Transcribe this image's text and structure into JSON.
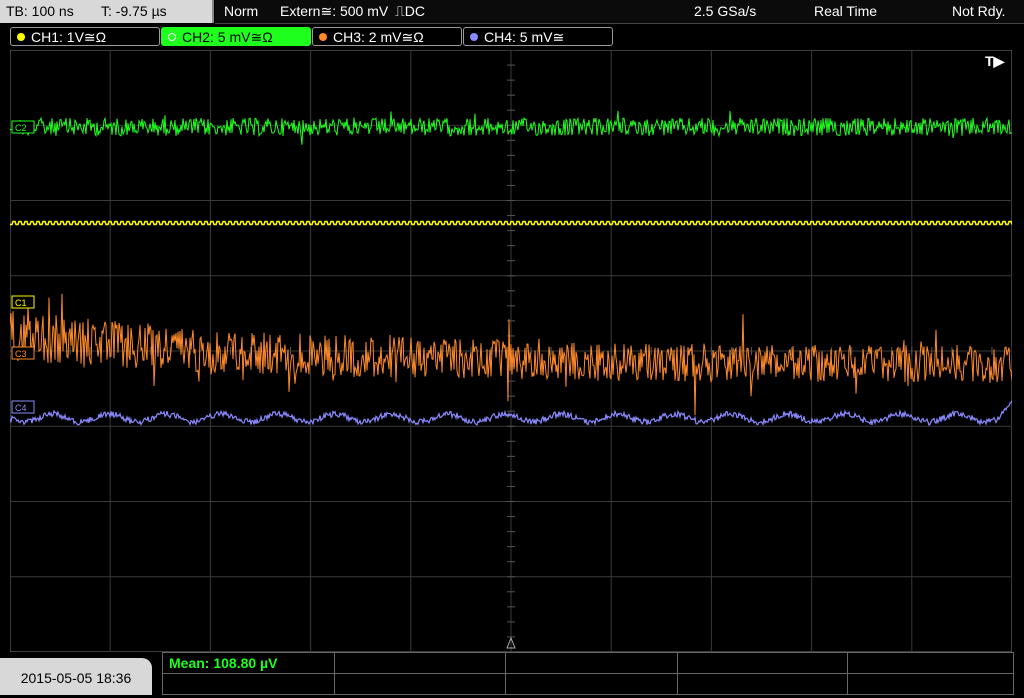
{
  "topbar": {
    "timebase": "TB: 100 ns",
    "trigger_time": "T: -9.75 µs",
    "mode": "Norm",
    "trigger_source": "Extern≅: 500 mV",
    "trigger_slope_coupling": "⎍DC",
    "sample_rate": "2.5 GSa/s",
    "acq_mode": "Real Time",
    "status": "Not Rdy."
  },
  "channels": [
    {
      "label": "CH1: 1V≅Ω",
      "color": "#ffff00",
      "active": false
    },
    {
      "label": "CH2: 5 mV≅Ω",
      "color": "#1eff1e",
      "active": true
    },
    {
      "label": "CH3: 2 mV≅Ω",
      "color": "#ff8a2a",
      "active": false
    },
    {
      "label": "CH4: 5 mV≅",
      "color": "#8a8aff",
      "active": false
    }
  ],
  "grid": {
    "marker_labels": {
      "c1": "C1",
      "c2": "C2",
      "c3": "C3",
      "c4": "C4",
      "trigger": "T▶"
    }
  },
  "traces": {
    "ch1_color": "#ffff00",
    "ch2_color": "#1eff1e",
    "ch3_color": "#ff8a2a",
    "ch4_color": "#8a8aff"
  },
  "bottombar": {
    "datetime": "2015-05-05 18:36",
    "measurement": "Mean: 108.80 µV"
  }
}
